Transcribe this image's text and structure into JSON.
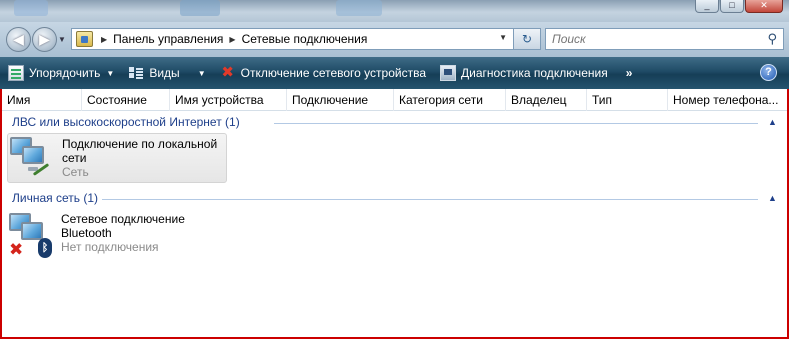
{
  "window": {
    "controls": [
      "_",
      "□",
      "✕"
    ]
  },
  "address": {
    "breadcrumbs": [
      "Панель управления",
      "Сетевые подключения"
    ],
    "search_placeholder": "Поиск"
  },
  "toolbar": {
    "organize_label": "Упорядочить",
    "views_label": "Виды",
    "disconnect_label": "Отключение сетевого устройства",
    "diagnose_label": "Диагностика подключения",
    "more_label": "»",
    "help_label": "?"
  },
  "columns": [
    "Имя",
    "Состояние",
    "Имя устройства",
    "Подключение",
    "Категория сети",
    "Владелец",
    "Тип",
    "Номер телефона..."
  ],
  "groups": [
    {
      "title": "ЛВС или высокоскоростной Интернет (1)",
      "items": [
        {
          "name_line1": "Подключение по локальной",
          "name_line2": "сети",
          "status": "Сеть",
          "icon": "lan-connection-icon"
        }
      ]
    },
    {
      "title": "Личная сеть (1)",
      "items": [
        {
          "name_line1": "Сетевое подключение",
          "name_line2": "Bluetooth",
          "status": "Нет подключения",
          "icon": "bluetooth-connection-icon"
        }
      ]
    }
  ],
  "colors": {
    "group_title": "#1e3f8a",
    "status_text": "#8a8a8a",
    "frame_border": "#cc0000",
    "command_bar": "#1f4b66"
  }
}
